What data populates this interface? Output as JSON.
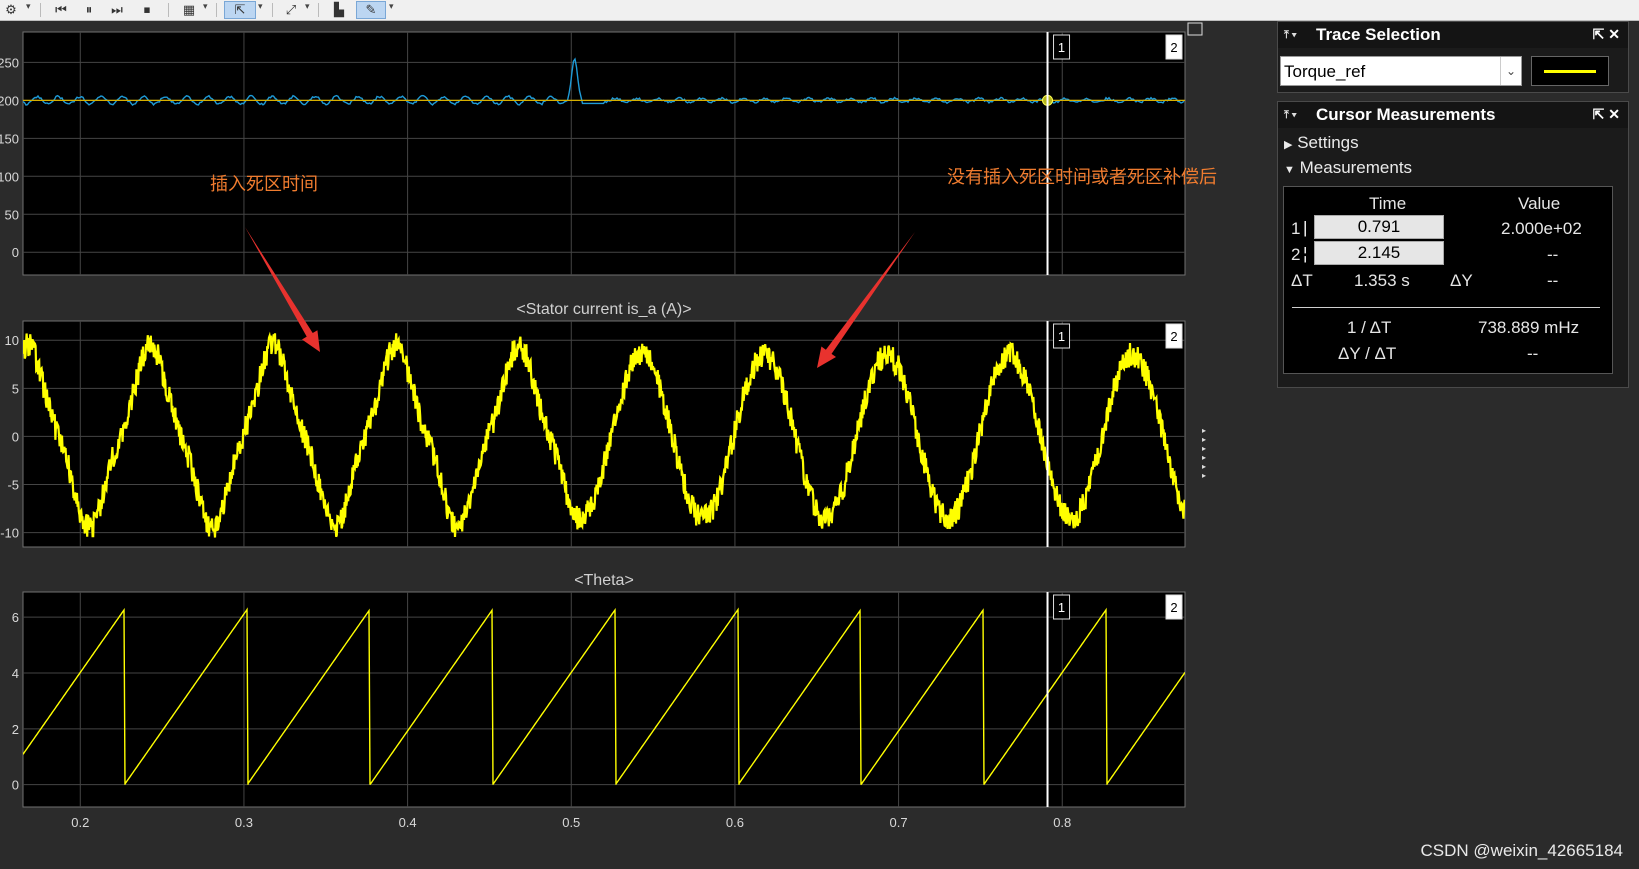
{
  "toolbar": {
    "icons": [
      "gear-icon",
      "step-back-icon",
      "pause-icon",
      "step-forward-icon",
      "stop-icon",
      "layout-icon",
      "cursor-icon",
      "zoom-icon",
      "highlight-icon",
      "measure-icon"
    ]
  },
  "colors": {
    "background": "#000000",
    "grid": "#454545",
    "yellow": "#ffff00",
    "blue": "#1e9bd8",
    "annotation_text": "#f07c2f",
    "arrow": "#e8322e",
    "cursor": "#ffffff"
  },
  "cursors": {
    "c1_label": "1",
    "c2_label": "2",
    "c1_x": 0.791,
    "c2_x": 2.145
  },
  "x_ticks": [
    "0.2",
    "0.3",
    "0.4",
    "0.5",
    "0.6",
    "0.7",
    "0.8"
  ],
  "annotations": {
    "left": "插入死区时间",
    "right": "没有插入死区时间或者死区补偿后"
  },
  "trace_selection": {
    "title": "Trace Selection",
    "selected": "Torque_ref",
    "swatch_color": "#ffff00"
  },
  "cursor_measurements": {
    "title": "Cursor Measurements",
    "settings": "Settings",
    "measurements": "Measurements",
    "col_time": "Time",
    "col_value": "Value",
    "row1_label": "1",
    "row1_time": "0.791",
    "row1_value": "2.000e+02",
    "row2_label": "2",
    "row2_time": "2.145",
    "row2_value": "--",
    "dT_label": "ΔT",
    "dT_value": "1.353 s",
    "dY_label": "ΔY",
    "dY_value": "--",
    "inv_dT_label": "1 / ΔT",
    "inv_dT_value": "738.889 mHz",
    "dYdT_label": "ΔY / ΔT",
    "dYdT_value": "--"
  },
  "watermark": "CSDN @weixin_42665184",
  "chart_data": [
    {
      "type": "line",
      "title": "",
      "xlim": [
        0.165,
        0.875
      ],
      "ylim": [
        -30,
        290
      ],
      "y_ticks": [
        "250",
        "200",
        "150",
        "100",
        "50",
        "0"
      ],
      "series": [
        {
          "color": "#1e9bd8",
          "description": "oscillating around 200 with spike to ~255 at x=0.502, smaller ripple after 0.52",
          "x": [
            0.165,
            0.3,
            0.4,
            0.495,
            0.502,
            0.51,
            0.53,
            0.6,
            0.7,
            0.8,
            0.875
          ],
          "y": [
            200,
            200,
            200,
            200,
            255,
            200,
            200,
            200,
            200,
            200,
            200
          ]
        },
        {
          "color": "#ffff00",
          "x": [
            0.165,
            0.875
          ],
          "y": [
            200,
            200
          ]
        }
      ],
      "marker": {
        "x": 0.791,
        "y": 200
      }
    },
    {
      "type": "line",
      "title": "<Stator current is_a (A)>",
      "xlim": [
        0.165,
        0.875
      ],
      "ylim": [
        -11.5,
        12
      ],
      "y_ticks": [
        "10",
        "5",
        "0",
        "-5",
        "-10"
      ],
      "series": [
        {
          "color": "#ffff00",
          "description": "noisy sinusoid, amplitude ~8.5, period ~0.075; flattened near zero crossings for x<0.5",
          "amplitude": 8.5,
          "period": 0.075,
          "peak_x": 0.168
        }
      ]
    },
    {
      "type": "line",
      "title": "<Theta>",
      "xlim": [
        0.165,
        0.875
      ],
      "ylim": [
        -0.8,
        6.9
      ],
      "y_ticks": [
        "6",
        "4",
        "2",
        "0"
      ],
      "series": [
        {
          "color": "#ffff00",
          "description": "sawtooth 0 to 6.28, period ~0.075",
          "resets_x": [
            0.227,
            0.302,
            0.377,
            0.452,
            0.527,
            0.602,
            0.677,
            0.752,
            0.827
          ],
          "y_min": 0,
          "y_max": 6.28
        }
      ]
    }
  ]
}
